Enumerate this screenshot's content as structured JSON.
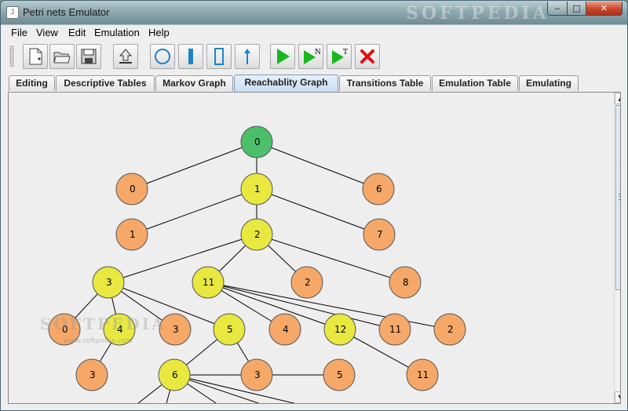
{
  "window": {
    "title": "Petri nets Emulator",
    "app_icon_glyph": "J",
    "watermark": "SOFTPEDIA",
    "controls": {
      "minimize": "‒",
      "maximize": "□",
      "close": "✕"
    }
  },
  "menu": [
    "File",
    "View",
    "Edit",
    "Emulation",
    "Help"
  ],
  "toolbar": {
    "buttons": [
      {
        "name": "new-document-icon"
      },
      {
        "name": "open-folder-icon"
      },
      {
        "name": "save-disk-icon"
      },
      {
        "name": "export-upload-icon"
      },
      {
        "name": "place-circle-icon"
      },
      {
        "name": "transition-filled-icon"
      },
      {
        "name": "transition-empty-icon"
      },
      {
        "name": "arc-arrow-icon"
      },
      {
        "name": "run-play-icon"
      },
      {
        "name": "run-n-steps-icon",
        "badge": "N"
      },
      {
        "name": "run-until-time-icon",
        "badge": "T"
      },
      {
        "name": "stop-cross-icon"
      }
    ]
  },
  "tabs": [
    {
      "label": "Editing"
    },
    {
      "label": "Descriptive Tables"
    },
    {
      "label": "Markov Graph"
    },
    {
      "label": "Reachablity Graph",
      "active": true
    },
    {
      "label": "Transitions Table"
    },
    {
      "label": "Emulation Table"
    },
    {
      "label": "Emulating"
    }
  ],
  "graph": {
    "colors": {
      "root": "#4cbf6a",
      "expanded": "#e8e840",
      "leaf": "#f6a868",
      "edge": "#000000"
    },
    "watermark": "SOFTPEDIA",
    "watermark_sub": "www.softpedia.com",
    "nodes": [
      {
        "id": "n0",
        "label": "0",
        "kind": "root"
      },
      {
        "id": "a0",
        "label": "0",
        "kind": "leaf"
      },
      {
        "id": "a1",
        "label": "1",
        "kind": "expanded"
      },
      {
        "id": "a6",
        "label": "6",
        "kind": "leaf"
      },
      {
        "id": "b1",
        "label": "1",
        "kind": "leaf"
      },
      {
        "id": "b2",
        "label": "2",
        "kind": "expanded"
      },
      {
        "id": "b7",
        "label": "7",
        "kind": "leaf"
      },
      {
        "id": "c3",
        "label": "3",
        "kind": "expanded"
      },
      {
        "id": "c11",
        "label": "11",
        "kind": "expanded"
      },
      {
        "id": "c2",
        "label": "2",
        "kind": "leaf"
      },
      {
        "id": "c8",
        "label": "8",
        "kind": "leaf"
      },
      {
        "id": "d0",
        "label": "0",
        "kind": "leaf"
      },
      {
        "id": "d4a",
        "label": "4",
        "kind": "expanded"
      },
      {
        "id": "d3",
        "label": "3",
        "kind": "leaf"
      },
      {
        "id": "d5",
        "label": "5",
        "kind": "expanded"
      },
      {
        "id": "d4b",
        "label": "4",
        "kind": "leaf"
      },
      {
        "id": "d12",
        "label": "12",
        "kind": "expanded"
      },
      {
        "id": "d11",
        "label": "11",
        "kind": "leaf"
      },
      {
        "id": "d2",
        "label": "2",
        "kind": "leaf"
      },
      {
        "id": "e3a",
        "label": "3",
        "kind": "leaf"
      },
      {
        "id": "e6",
        "label": "6",
        "kind": "expanded"
      },
      {
        "id": "e3b",
        "label": "3",
        "kind": "leaf"
      },
      {
        "id": "e5",
        "label": "5",
        "kind": "leaf"
      },
      {
        "id": "e11",
        "label": "11",
        "kind": "leaf"
      }
    ],
    "edges": [
      [
        "n0",
        "a0"
      ],
      [
        "n0",
        "a1"
      ],
      [
        "n0",
        "a6"
      ],
      [
        "a1",
        "b1"
      ],
      [
        "a1",
        "b2"
      ],
      [
        "a1",
        "b7"
      ],
      [
        "b2",
        "c3"
      ],
      [
        "b2",
        "c11"
      ],
      [
        "b2",
        "c2"
      ],
      [
        "b2",
        "c8"
      ],
      [
        "c3",
        "d0"
      ],
      [
        "c3",
        "d4a"
      ],
      [
        "c3",
        "d3"
      ],
      [
        "c3",
        "d5"
      ],
      [
        "c11",
        "d4b"
      ],
      [
        "c11",
        "d12"
      ],
      [
        "c11",
        "d11"
      ],
      [
        "c11",
        "d2"
      ],
      [
        "d4a",
        "e3a"
      ],
      [
        "d5",
        "e6"
      ],
      [
        "d5",
        "e3b"
      ],
      [
        "d12",
        "e11"
      ],
      [
        "e6",
        "e5"
      ]
    ]
  }
}
